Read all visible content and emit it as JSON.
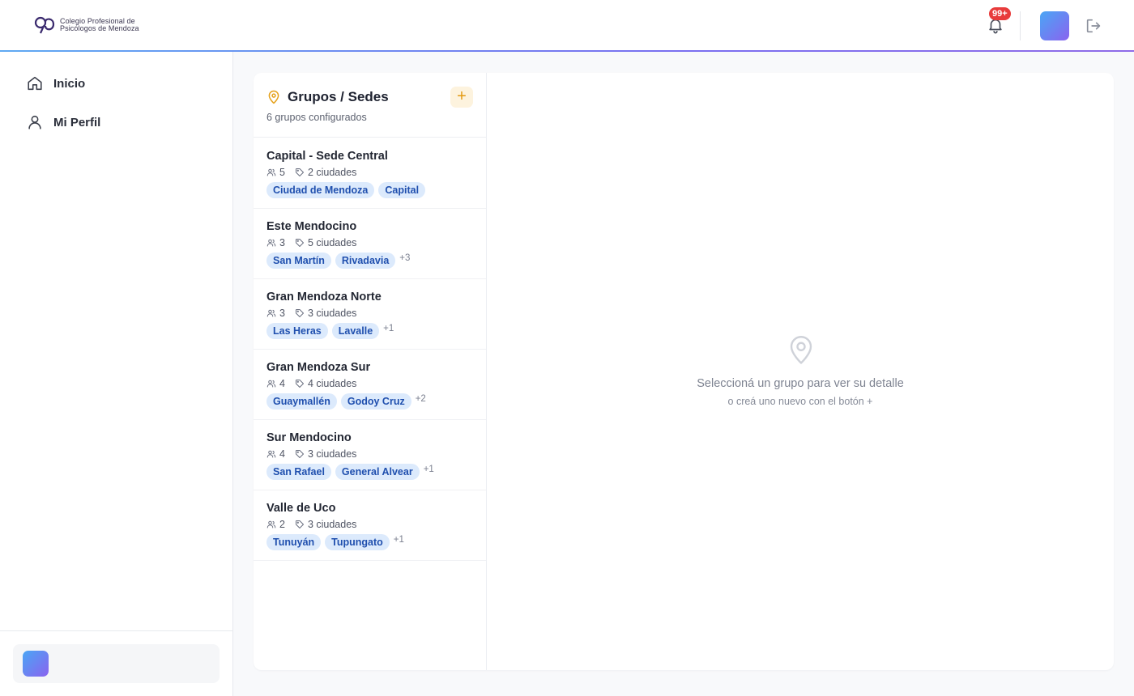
{
  "header": {
    "logo_line1": "Colegio Profesional de",
    "logo_line2": "Psicólogos de Mendoza",
    "notifications_badge": "99+"
  },
  "sidebar": {
    "items": [
      {
        "label": "Inicio",
        "icon": "home-icon"
      },
      {
        "label": "Mi Perfil",
        "icon": "user-icon"
      }
    ]
  },
  "groups_panel": {
    "title": "Grupos / Sedes",
    "subtitle": "6 grupos configurados",
    "add_label": "+"
  },
  "groups": [
    {
      "name": "Capital - Sede Central",
      "members": "5",
      "cities_label": "2 ciudades",
      "tags": [
        "Ciudad de Mendoza",
        "Capital"
      ],
      "more": ""
    },
    {
      "name": "Este Mendocino",
      "members": "3",
      "cities_label": "5 ciudades",
      "tags": [
        "San Martín",
        "Rivadavia"
      ],
      "more": "+3"
    },
    {
      "name": "Gran Mendoza Norte",
      "members": "3",
      "cities_label": "3 ciudades",
      "tags": [
        "Las Heras",
        "Lavalle"
      ],
      "more": "+1"
    },
    {
      "name": "Gran Mendoza Sur",
      "members": "4",
      "cities_label": "4 ciudades",
      "tags": [
        "Guaymallén",
        "Godoy Cruz"
      ],
      "more": "+2"
    },
    {
      "name": "Sur Mendocino",
      "members": "4",
      "cities_label": "3 ciudades",
      "tags": [
        "San Rafael",
        "General Alvear"
      ],
      "more": "+1"
    },
    {
      "name": "Valle de Uco",
      "members": "2",
      "cities_label": "3 ciudades",
      "tags": [
        "Tunuyán",
        "Tupungato"
      ],
      "more": "+1"
    }
  ],
  "detail": {
    "empty_title": "Seleccioná un grupo para ver su detalle",
    "empty_subtitle": "o creá uno nuevo con el botón +"
  },
  "colors": {
    "accent_gradient_start": "#4aa6f5",
    "accent_gradient_end": "#8a63ef",
    "tag_bg": "#dceafc",
    "tag_text": "#1f4fae",
    "add_accent": "#e39a12",
    "badge_red": "#e83b3b"
  }
}
